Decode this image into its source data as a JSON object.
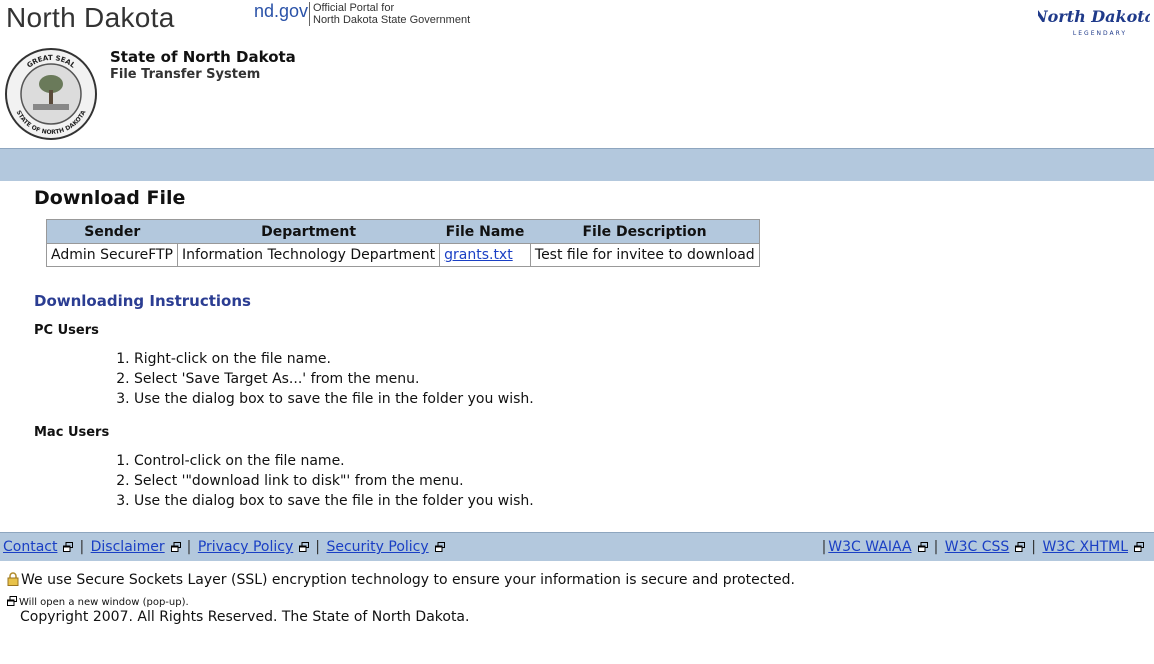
{
  "header": {
    "wordmark": "North Dakota",
    "ndgov": "nd.gov",
    "portal_line1": "Official Portal for",
    "portal_line2": "North Dakota State Government",
    "legendary_logo_text": "North Dakota",
    "legendary_tagline": "LEGENDARY",
    "seal_text_top": "GREAT SEAL",
    "seal_text_bottom": "STATE OF NORTH DAKOTA",
    "state_title": "State of North Dakota",
    "system_title": "File Transfer System"
  },
  "download": {
    "title": "Download File",
    "columns": [
      "Sender",
      "Department",
      "File Name",
      "File Description"
    ],
    "rows": [
      [
        "Admin SecureFTP",
        "Information Technology Department",
        "grants.txt",
        "Test file for invitee to download"
      ]
    ]
  },
  "instructions": {
    "title": "Downloading Instructions",
    "pc_title": "PC Users",
    "pc_steps": [
      "Right-click on the file name.",
      "Select 'Save Target As...' from the menu.",
      "Use the dialog box to save the file in the folder you wish."
    ],
    "mac_title": "Mac Users",
    "mac_steps": [
      "Control-click on the file name.",
      "Select '\"download link to disk\"' from the menu.",
      "Use the dialog box to save the file in the folder you wish."
    ]
  },
  "footer": {
    "left_links": [
      "Contact",
      "Disclaimer",
      "Privacy Policy",
      "Security Policy"
    ],
    "right_links": [
      "W3C WAIAA",
      "W3C CSS",
      "W3C XHTML"
    ],
    "separator": "|",
    "ssl_text": "We use Secure Sockets Layer (SSL) encryption technology to ensure your information is secure and protected.",
    "popup_note": "Will open a new window (pop-up).",
    "copyright": "Copyright 2007. All Rights Reserved. The State of North Dakota."
  },
  "colors": {
    "bar": "#b3c8dd",
    "link": "#1a3fc4",
    "heading_blue": "#2b3d92"
  }
}
